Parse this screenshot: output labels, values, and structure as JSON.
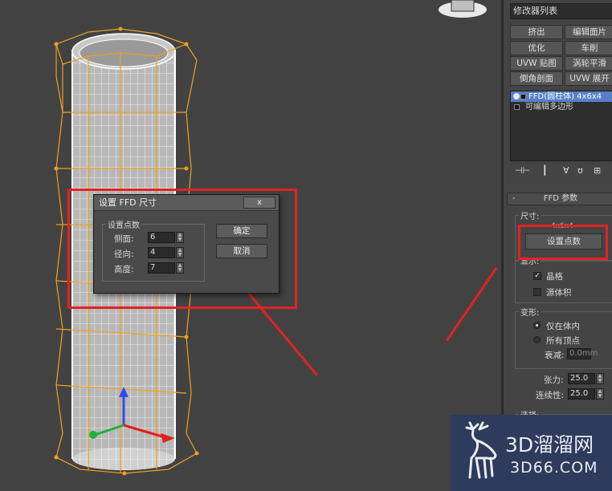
{
  "modifier_list": {
    "label": "修改器列表"
  },
  "modifier_buttons": [
    "挤出",
    "编辑面片",
    "优化",
    "车削",
    "UVW 贴图",
    "涡轮平滑",
    "倒角剖面",
    "UVW 展开"
  ],
  "stack": {
    "items": [
      {
        "label": "FFD(圆柱体) 4x6x4",
        "selected": true
      },
      {
        "label": "可编辑多边形",
        "selected": false
      }
    ]
  },
  "ffd_params": {
    "title": "FFD 参数",
    "dimensions_label": "尺寸:",
    "dimensions_value": "4x6x4",
    "set_points_button": "设置点数",
    "display_label": "显示:",
    "lattice_label": "晶格",
    "lattice_checked": true,
    "source_volume_label": "源体积",
    "source_volume_checked": false,
    "deform_label": "变形:",
    "only_in_volume_label": "仅在体内",
    "all_vertices_label": "所有顶点",
    "falloff_label": "衰减:",
    "falloff_value": "0.0mm",
    "tension_label": "张力:",
    "tension_value": "25.0",
    "continuity_label": "连续性:",
    "continuity_value": "25.0",
    "select_label": "选择:"
  },
  "dialog": {
    "title": "设置 FFD 尺寸",
    "close_label": "x",
    "group_label": "设置点数",
    "sides_label": "侧面:",
    "sides_value": "6",
    "radial_label": "径向:",
    "radial_value": "4",
    "height_label": "高度:",
    "height_value": "7",
    "ok_button": "确定",
    "cancel_button": "取消"
  },
  "watermark": {
    "brand": "3D溜溜网",
    "domain": "3D66.COM"
  },
  "colors": {
    "annotation_red": "#e32222",
    "lattice_orange": "#f0a020",
    "selection_blue": "#5680c8"
  }
}
